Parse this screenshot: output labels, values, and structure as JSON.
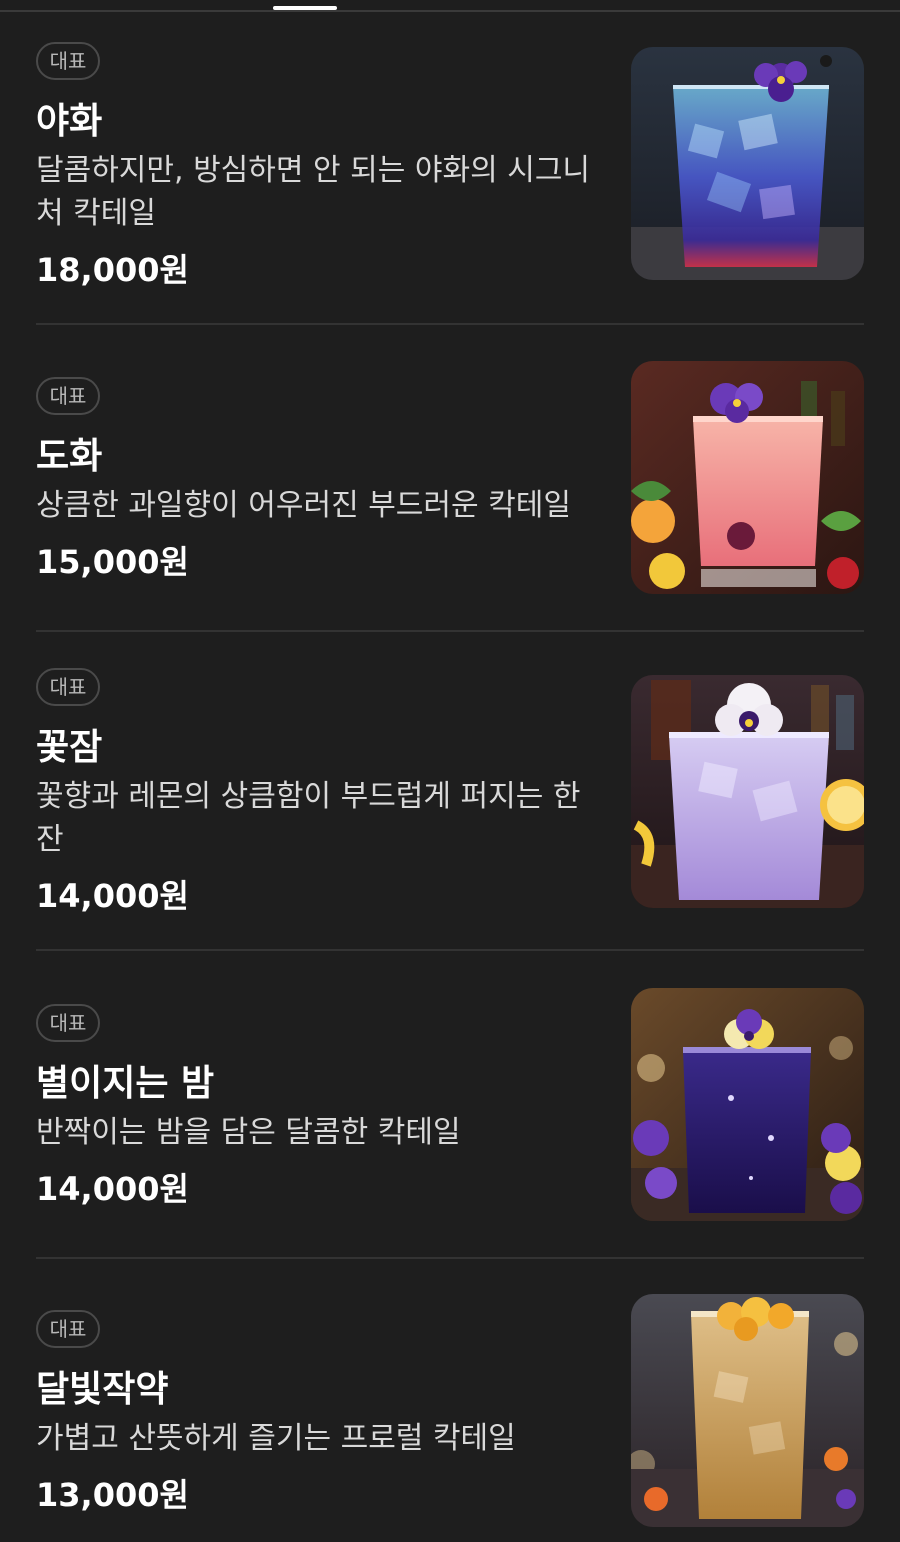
{
  "menu": {
    "items": [
      {
        "badge": "대표",
        "name": "야화",
        "description": "달콤하지만, 방심하면 안 되는 야화의 시그니처 칵테일",
        "price": "18,000원",
        "image_icon": "blue-cocktail-image"
      },
      {
        "badge": "대표",
        "name": "도화",
        "description": "상큼한 과일향이 어우러진 부드러운 칵테일",
        "price": "15,000원",
        "image_icon": "pink-cocktail-image"
      },
      {
        "badge": "대표",
        "name": "꽃잠",
        "description": "꽃향과 레몬의 상큼함이 부드럽게 퍼지는 한 잔",
        "price": "14,000원",
        "image_icon": "lavender-cocktail-image"
      },
      {
        "badge": "대표",
        "name": "별이지는 밤",
        "description": "반짝이는 밤을 담은 달콤한 칵테일",
        "price": "14,000원",
        "image_icon": "purple-cocktail-image"
      },
      {
        "badge": "대표",
        "name": "달빛작약",
        "description": "가볍고 산뜻하게 즐기는 프로럴 칵테일",
        "price": "13,000원",
        "image_icon": "amber-cocktail-image"
      }
    ]
  },
  "colors": {
    "background": "#1e1e1e",
    "divider": "#333333",
    "badge_border": "#4a4a4a",
    "text_primary": "#ffffff",
    "text_secondary": "#d9d9d9"
  }
}
